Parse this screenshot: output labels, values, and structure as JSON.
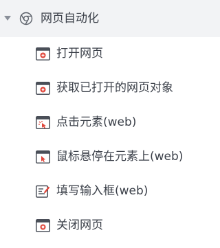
{
  "group": {
    "label": "网页自动化",
    "icon": "chrome-icon",
    "expanded": true
  },
  "items": [
    {
      "label": "打开网页",
      "icon": "open-webpage-icon"
    },
    {
      "label": "获取已打开的网页对象",
      "icon": "get-webpage-object-icon"
    },
    {
      "label": "点击元素(web)",
      "icon": "click-element-icon"
    },
    {
      "label": "鼠标悬停在元素上(web)",
      "icon": "hover-element-icon"
    },
    {
      "label": "填写输入框(web)",
      "icon": "fill-input-icon"
    },
    {
      "label": "关闭网页",
      "icon": "close-webpage-icon"
    }
  ],
  "colors": {
    "header_bg": "#f2f3f5",
    "text": "#3a3f48",
    "icon_dark": "#4a4f58",
    "accent_red": "#e0453a"
  }
}
